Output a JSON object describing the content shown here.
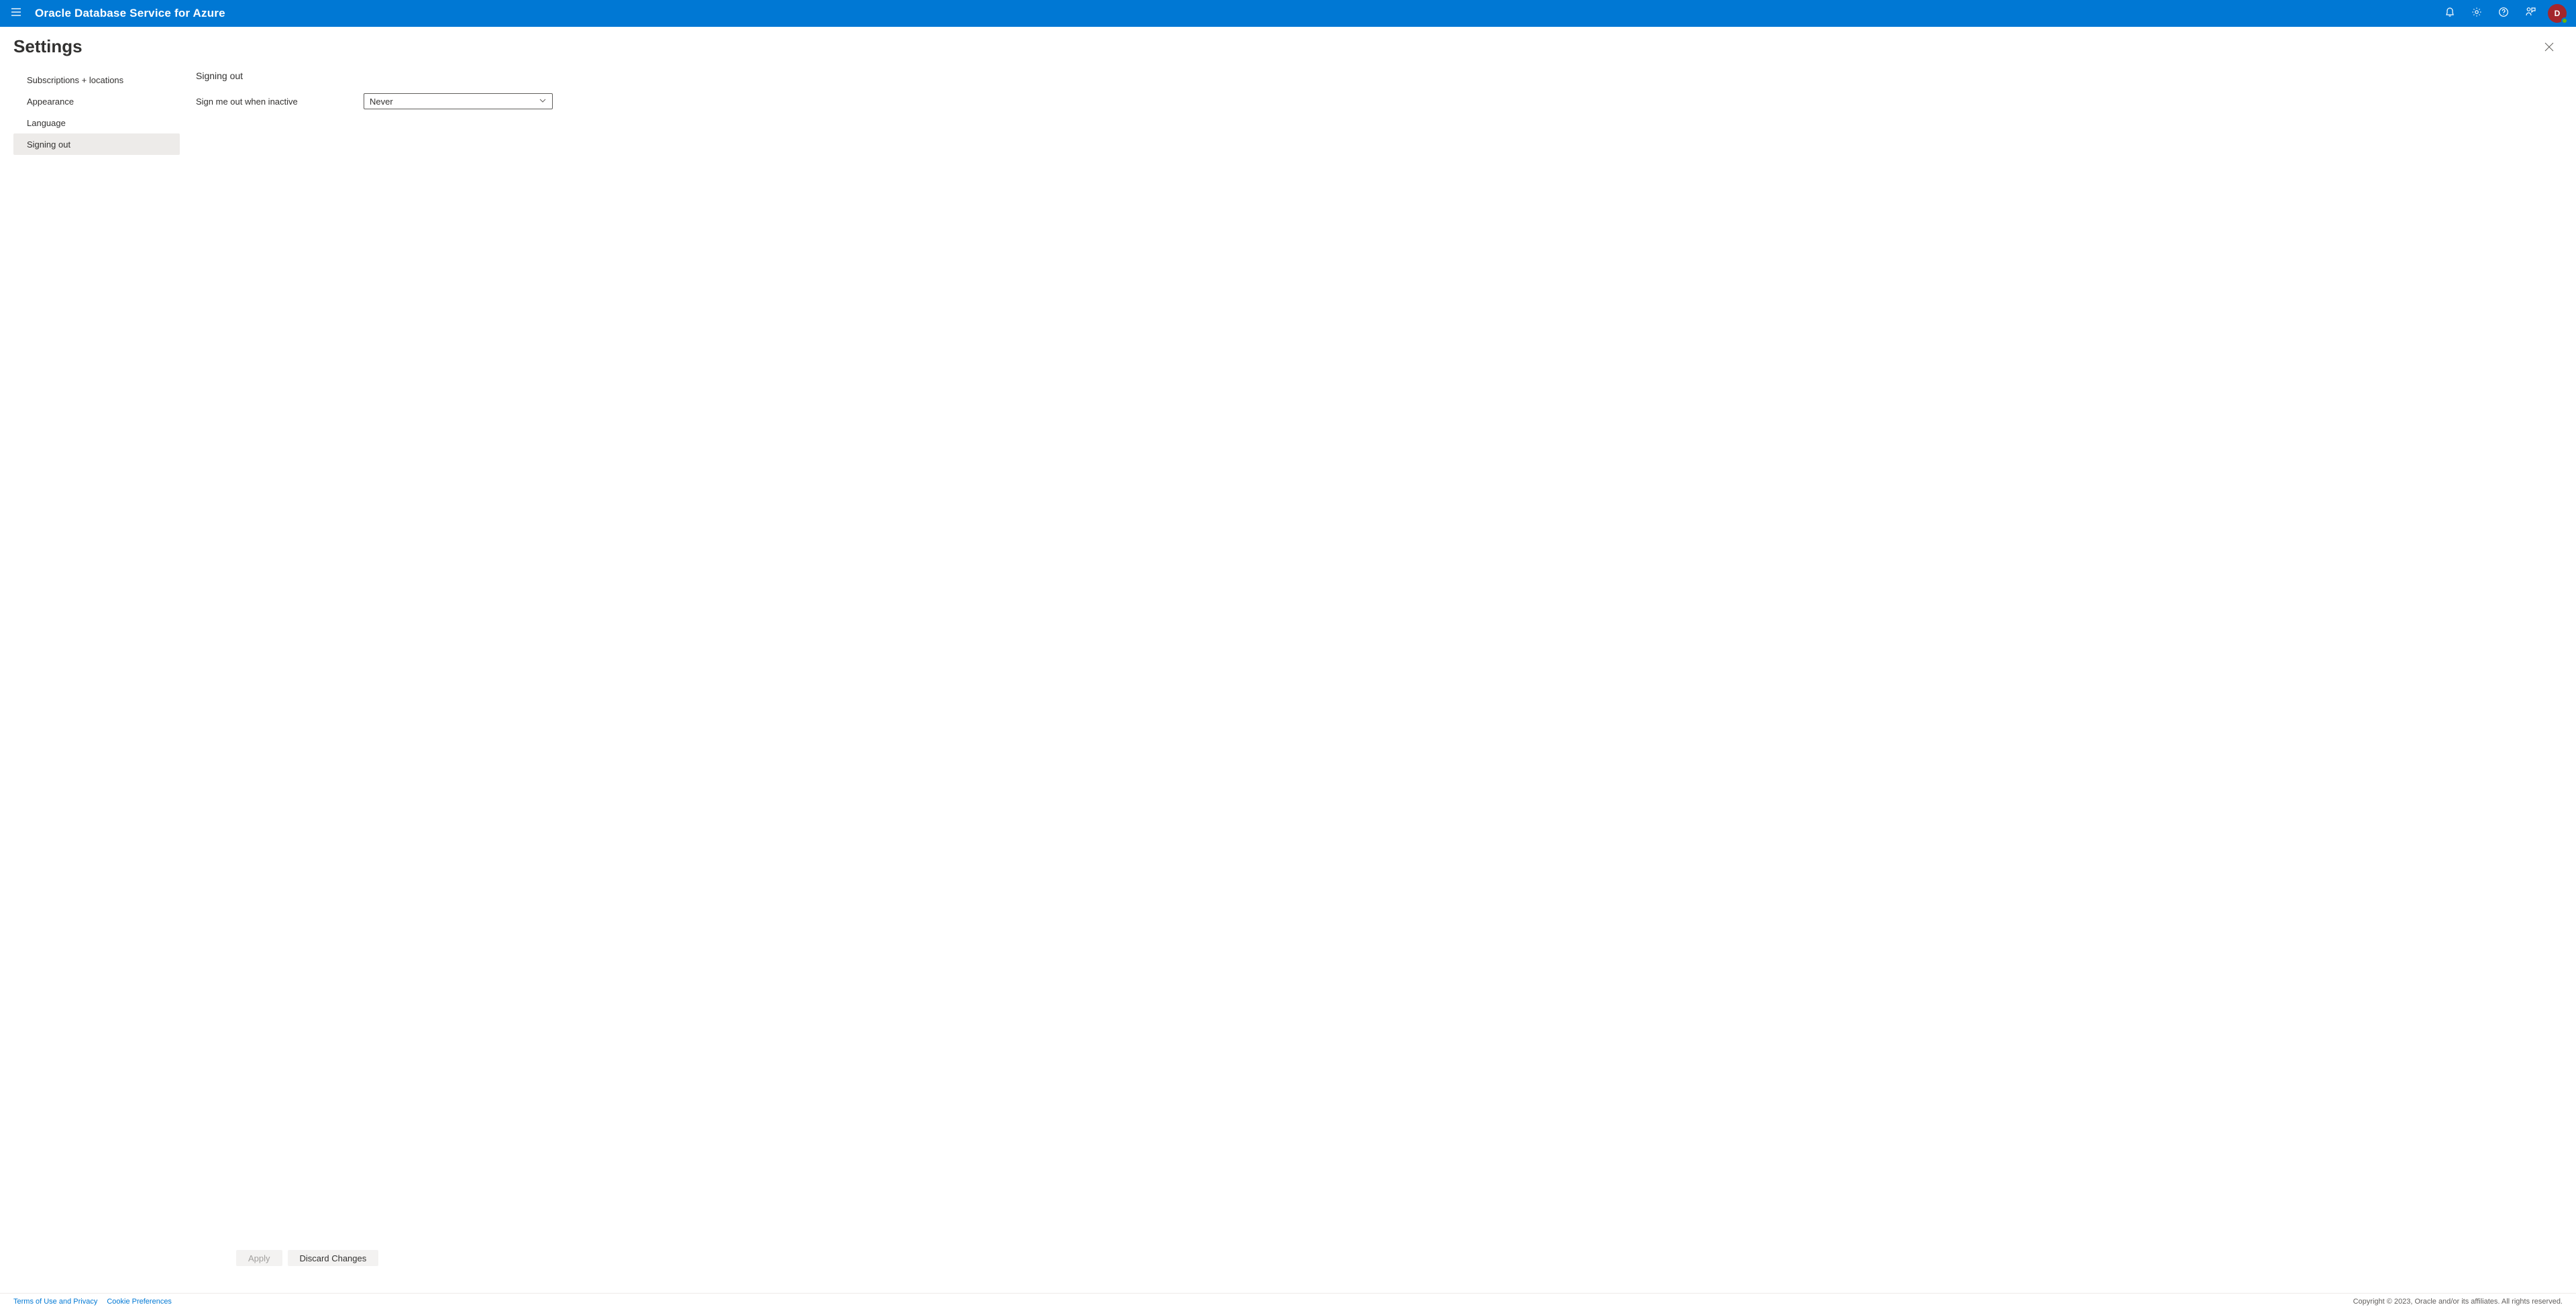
{
  "header": {
    "brand": "Oracle Database Service for Azure",
    "avatar_initial": "D"
  },
  "page": {
    "title": "Settings"
  },
  "nav": {
    "items": [
      {
        "label": "Subscriptions + locations",
        "selected": false
      },
      {
        "label": "Appearance",
        "selected": false
      },
      {
        "label": "Language",
        "selected": false
      },
      {
        "label": "Signing out",
        "selected": true
      }
    ]
  },
  "content": {
    "section_title": "Signing out",
    "field_label": "Sign me out when inactive",
    "dropdown_value": "Never",
    "apply_label": "Apply",
    "discard_label": "Discard Changes"
  },
  "footer": {
    "terms_label": "Terms of Use and Privacy",
    "cookies_label": "Cookie Preferences",
    "copyright": "Copyright © 2023, Oracle and/or its affiliates. All rights reserved."
  }
}
